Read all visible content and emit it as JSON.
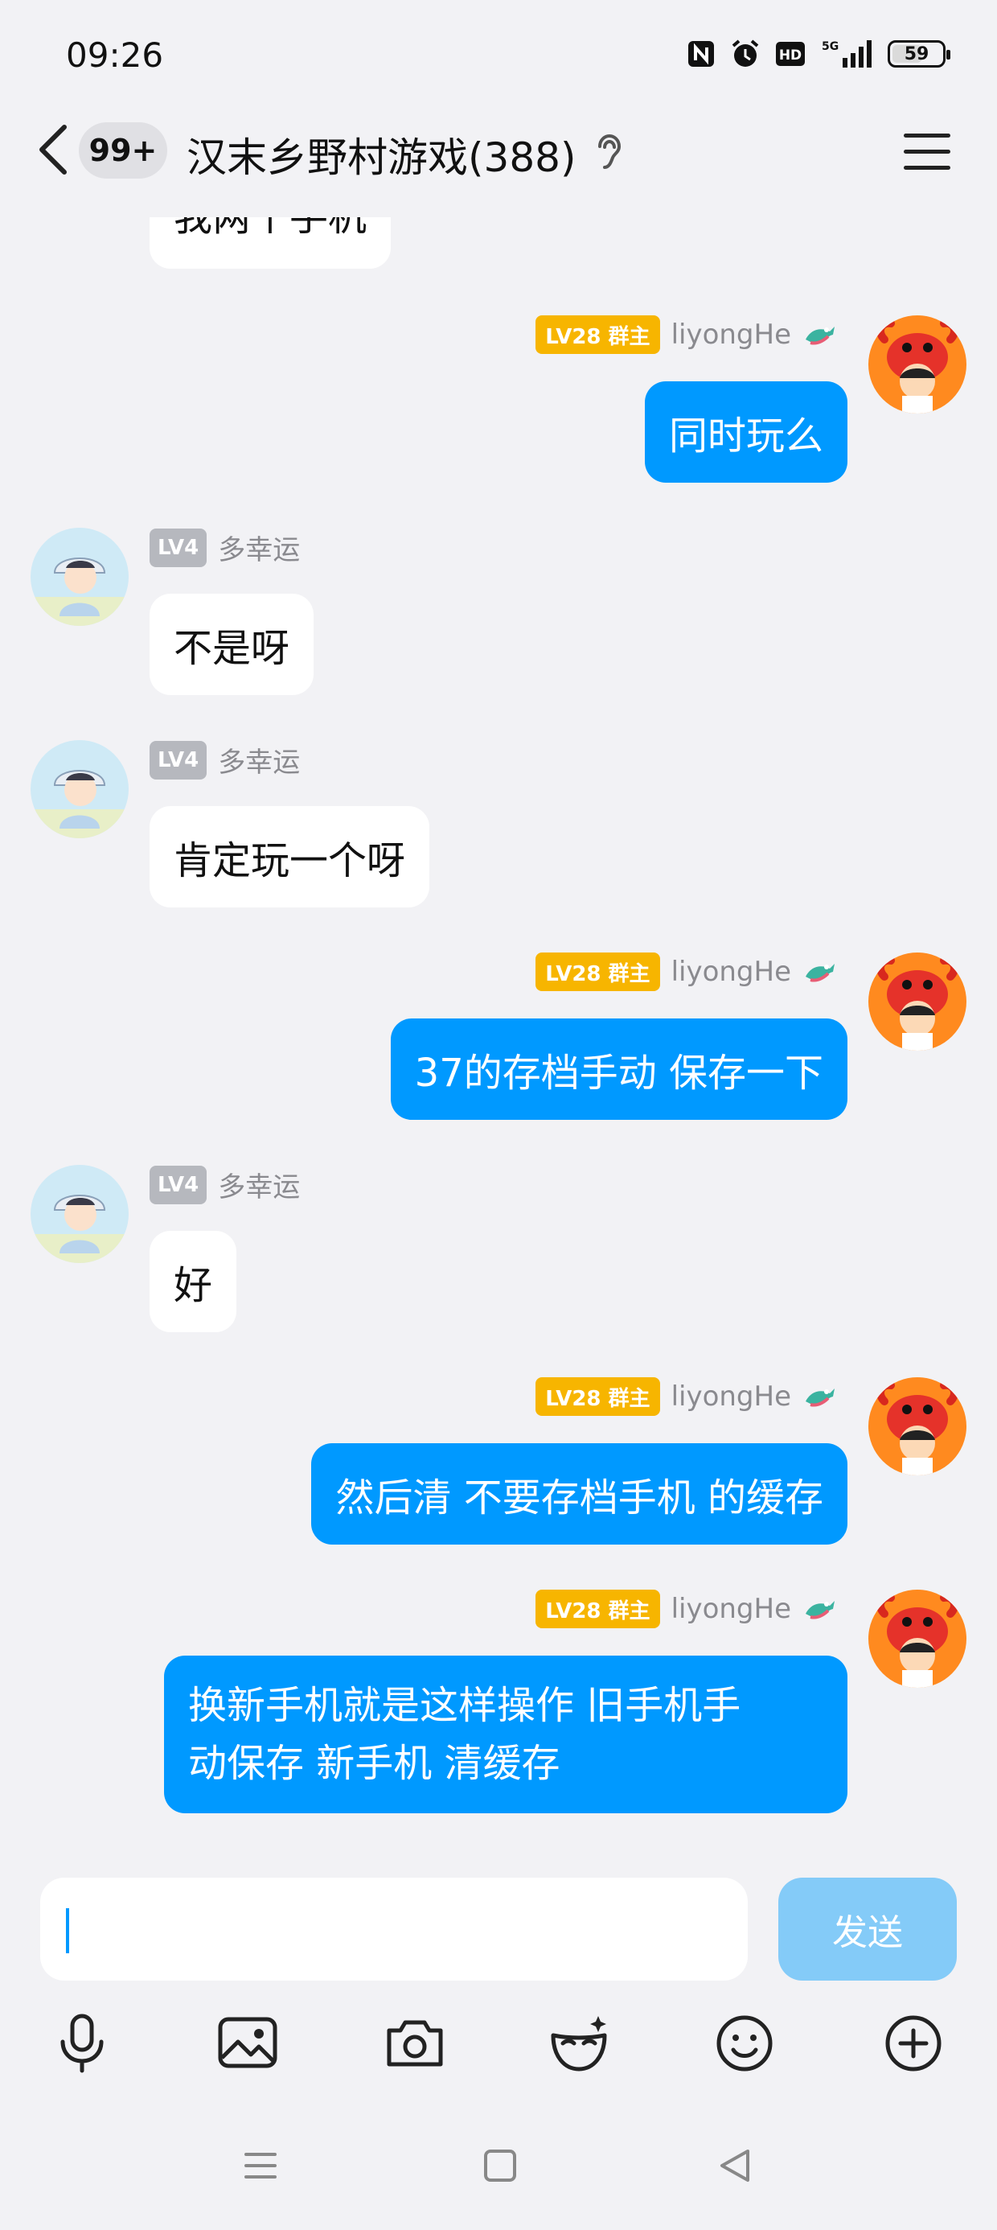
{
  "status_bar": {
    "time": "09:26",
    "battery": "59"
  },
  "header": {
    "unread_badge": "99+",
    "title": "汉末乡野村游戏(388)"
  },
  "colors": {
    "accent": "#0099FF",
    "bubble_in": "#FFFFFF",
    "level_gold": "#F7B500",
    "level_gray": "#B6B8BE",
    "background": "#F2F2F5"
  },
  "messages": [
    {
      "direction": "in",
      "text": "我两个手机"
    },
    {
      "direction": "out",
      "level": "LV28 群主",
      "sender": "liyongHe",
      "text": "同时玩么"
    },
    {
      "direction": "in",
      "level": "LV4",
      "sender": "多幸运",
      "text": "不是呀"
    },
    {
      "direction": "in",
      "level": "LV4",
      "sender": "多幸运",
      "text": "肯定玩一个呀"
    },
    {
      "direction": "out",
      "level": "LV28 群主",
      "sender": "liyongHe",
      "text": "37的存档手动 保存一下"
    },
    {
      "direction": "in",
      "level": "LV4",
      "sender": "多幸运",
      "text": "好"
    },
    {
      "direction": "out",
      "level": "LV28 群主",
      "sender": "liyongHe",
      "text": "然后清 不要存档手机 的缓存"
    },
    {
      "direction": "out",
      "level": "LV28 群主",
      "sender": "liyongHe",
      "text_lines": [
        "换新手机就是这样操作 旧手机手",
        "动保存 新手机 清缓存"
      ]
    }
  ],
  "composer": {
    "value": "",
    "send_label": "发送"
  },
  "toolbar_icons": [
    "microphone-icon",
    "image-icon",
    "camera-icon",
    "mask-icon",
    "emoji-icon",
    "plus-icon"
  ],
  "nav_icons": [
    "menu-icon",
    "home-icon",
    "back-icon"
  ]
}
